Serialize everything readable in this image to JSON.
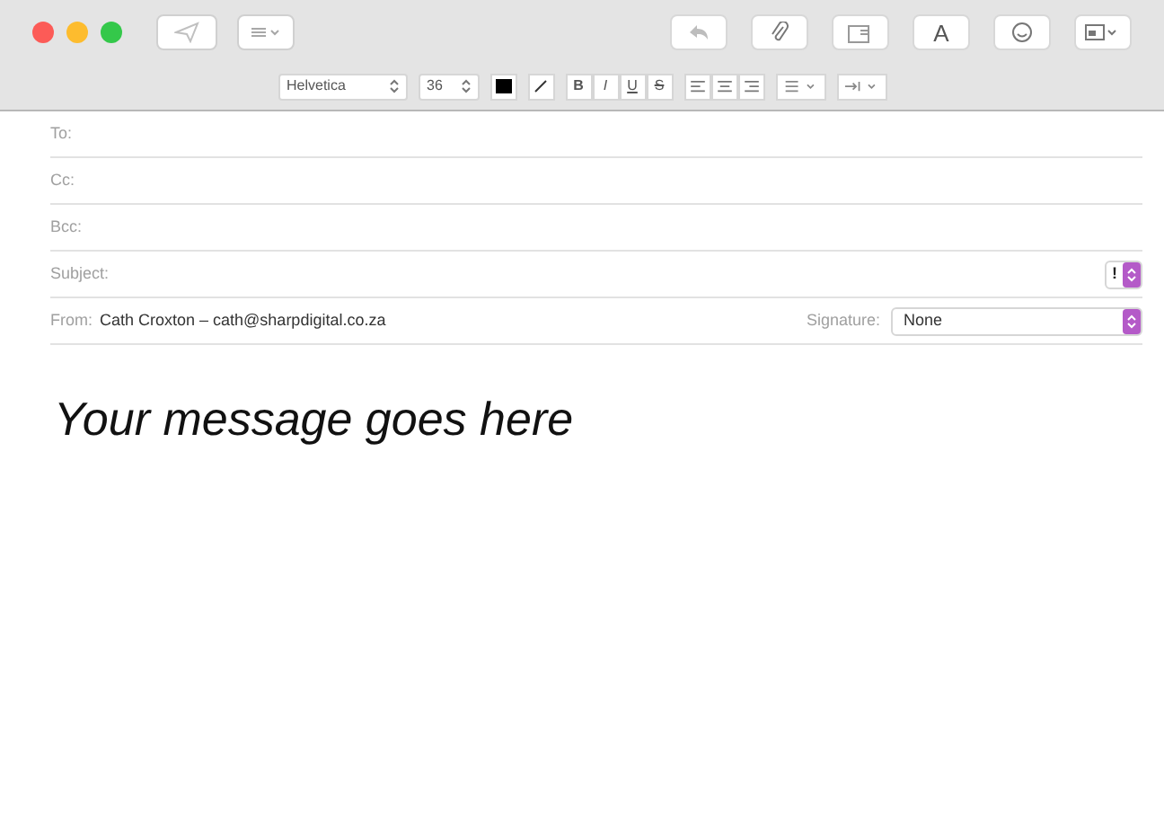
{
  "toolbar": {
    "font_button": "A"
  },
  "format_bar": {
    "font": "Helvetica",
    "size": "36",
    "styles": [
      "B",
      "I",
      "U",
      "S"
    ]
  },
  "header_fields": [
    {
      "label": "To:"
    },
    {
      "label": "Cc:"
    },
    {
      "label": "Bcc:"
    },
    {
      "label": "Subject:",
      "priority": "!"
    }
  ],
  "from": {
    "label": "From:",
    "value": "Cath Croxton – cath@sharpdigital.co.za",
    "signature_label": "Signature:",
    "signature": "None"
  },
  "body": "Your message goes here"
}
